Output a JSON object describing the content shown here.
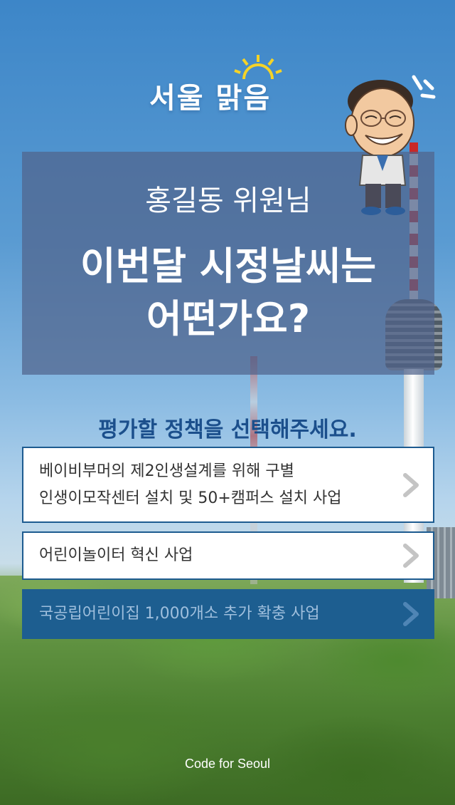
{
  "logo": {
    "text": "서울 맑음"
  },
  "headline": {
    "name": "홍길동 위원님",
    "question_line1": "이번달 시정날씨는",
    "question_line2": "어떤가요?"
  },
  "prompt": "평가할 정책을 선택해주세요.",
  "policies": [
    {
      "label": "베이비부머의 제2인생설계를 위해 구별\n인생이모작센터 설치 및 50+캠퍼스 설치 사업",
      "style": "white"
    },
    {
      "label": "어린이놀이터 혁신 사업",
      "style": "white"
    },
    {
      "label": "국공립어린이집 1,000개소 추가 확충 사업",
      "style": "selected"
    }
  ],
  "footer": "Code for Seoul",
  "colors": {
    "accent_blue": "#1d5e90",
    "prompt_blue": "#1b4f8c",
    "chevron_gray": "#c4c4c4",
    "sun_yellow": "#f5d327"
  }
}
